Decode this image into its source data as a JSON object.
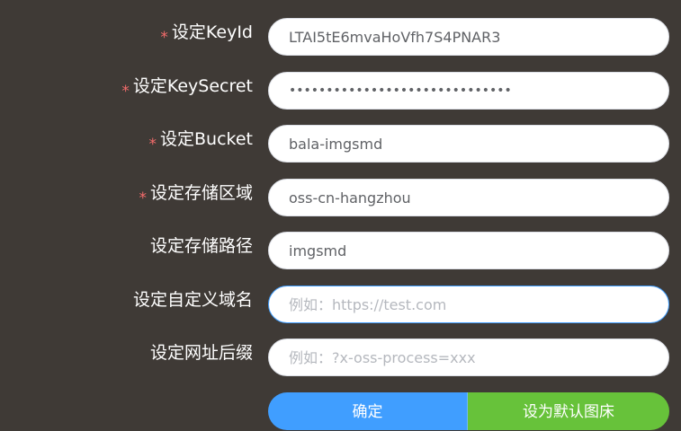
{
  "form": {
    "fields": [
      {
        "label": "设定KeyId",
        "required": true,
        "value": "LTAI5tE6mvaHoVfh7S4PNAR3",
        "placeholder": ""
      },
      {
        "label": "设定KeySecret",
        "required": true,
        "value": "••••••••••••••••••••••••••••••",
        "placeholder": ""
      },
      {
        "label": "设定Bucket",
        "required": true,
        "value": "bala-imgsmd",
        "placeholder": ""
      },
      {
        "label": "设定存储区域",
        "required": true,
        "value": "oss-cn-hangzhou",
        "placeholder": ""
      },
      {
        "label": "设定存储路径",
        "required": false,
        "value": "imgsmd",
        "placeholder": ""
      },
      {
        "label": "设定自定义域名",
        "required": false,
        "value": "",
        "placeholder": "例如：https://test.com"
      },
      {
        "label": "设定网址后缀",
        "required": false,
        "value": "",
        "placeholder": "例如：?x-oss-process=xxx"
      }
    ],
    "required_mark": "*",
    "buttons": {
      "confirm_label": "确定",
      "set_default_label": "设为默认图床"
    }
  },
  "colors": {
    "background": "#3f3a36",
    "primary": "#409eff",
    "success": "#67c23a",
    "required": "#f56c6c"
  }
}
